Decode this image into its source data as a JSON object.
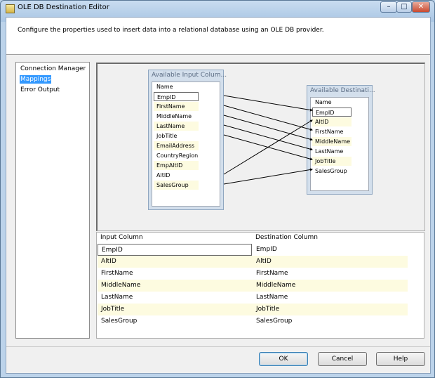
{
  "window": {
    "title": "OLE DB Destination Editor",
    "controls": {
      "minimize": "–",
      "maximize": "□",
      "close": "✕"
    }
  },
  "header": {
    "description": "Configure the properties used to insert data into a relational database using an OLE DB provider."
  },
  "nav": {
    "items": [
      {
        "label": "Connection Manager",
        "selected": false
      },
      {
        "label": "Mappings",
        "selected": true
      },
      {
        "label": "Error Output",
        "selected": false
      }
    ]
  },
  "input_columns": {
    "title": "Available Input Colum...",
    "header": "Name",
    "items": [
      "EmpID",
      "FirstName",
      "MiddleName",
      "LastName",
      "JobTitle",
      "EmailAddress",
      "CountryRegion",
      "EmpAltID",
      "AltID",
      "SalesGroup"
    ]
  },
  "destination_columns": {
    "title": "Available Destinati...",
    "header": "Name",
    "items": [
      "EmpID",
      "AltID",
      "FirstName",
      "MiddleName",
      "LastName",
      "JobTitle",
      "SalesGroup"
    ]
  },
  "grid": {
    "headers": {
      "input": "Input Column",
      "destination": "Destination Column"
    },
    "rows": [
      {
        "input": "EmpID",
        "destination": "EmpID"
      },
      {
        "input": "AltID",
        "destination": "AltID"
      },
      {
        "input": "FirstName",
        "destination": "FirstName"
      },
      {
        "input": "MiddleName",
        "destination": "MiddleName"
      },
      {
        "input": "LastName",
        "destination": "LastName"
      },
      {
        "input": "JobTitle",
        "destination": "JobTitle"
      },
      {
        "input": "SalesGroup",
        "destination": "SalesGroup"
      }
    ]
  },
  "buttons": {
    "ok": "OK",
    "cancel": "Cancel",
    "help": "Help"
  },
  "colors": {
    "selection": "#3399ff",
    "alt_row": "#fdfbe0",
    "window_frame": "#bcd3ea"
  }
}
